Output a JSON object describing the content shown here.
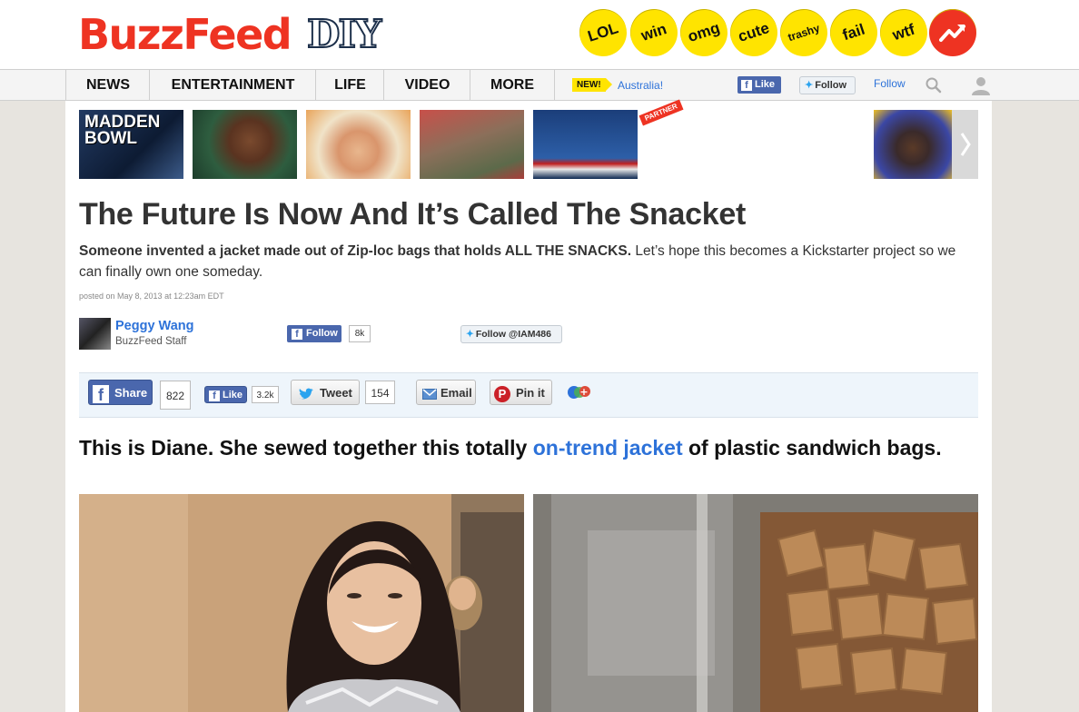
{
  "header": {
    "logo": "BuzzFeed",
    "logo_sub": "DIY",
    "badges": [
      "LOL",
      "win",
      "omg",
      "cute",
      "trashy",
      "fail",
      "wtf"
    ]
  },
  "nav": {
    "items": [
      "NEWS",
      "ENTERTAINMENT",
      "LIFE",
      "VIDEO",
      "MORE"
    ],
    "new_badge": "NEW!",
    "country": "Australia!",
    "fb_like": "Like",
    "tw_follow": "Follow",
    "follow_link": "Follow"
  },
  "thumbnails": {
    "partner_label": "PARTNER",
    "madden_text": "MADDEN BOWL"
  },
  "article": {
    "title": "The Future Is Now And It’s Called The Snacket",
    "description_bold": "Someone invented a jacket made out of Zip-loc bags that holds ALL THE SNACKS.",
    "description_rest": " Let’s hope this becomes a Kickstarter project so we can finally own one someday.",
    "posted": "posted on May 8, 2013 at 12:23am EDT"
  },
  "author": {
    "name": "Peggy Wang",
    "role": "BuzzFeed Staff",
    "fb_follow": "Follow",
    "fb_follow_count": "8k",
    "tw_follow": "Follow @IAM486"
  },
  "share": {
    "fb_share": "Share",
    "fb_share_count": "822",
    "fb_like": "Like",
    "fb_like_count": "3.2k",
    "tweet": "Tweet",
    "tweet_count": "154",
    "email": "Email",
    "pin": "Pin it"
  },
  "section": {
    "heading_before": "This is Diane. She sewed together this totally ",
    "heading_link": "on-trend jacket",
    "heading_after": " of plastic sandwich bags."
  },
  "colors": {
    "brand_red": "#ee3322",
    "link_blue": "#2d72d9",
    "badge_yellow": "#ffe400",
    "facebook_blue": "#4a67ad"
  }
}
